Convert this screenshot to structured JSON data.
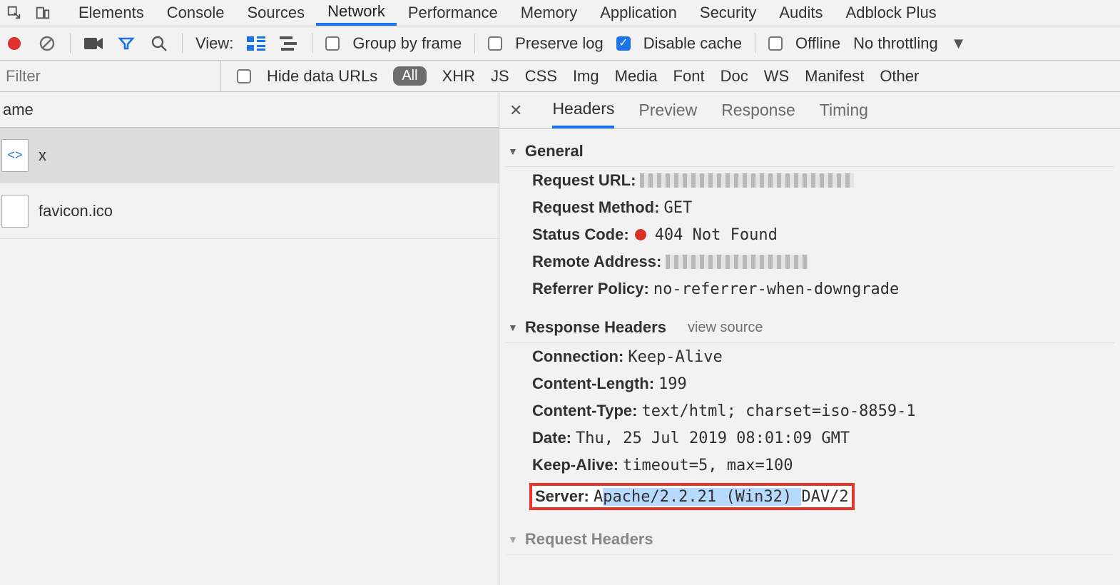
{
  "tabs": {
    "items": [
      "Elements",
      "Console",
      "Sources",
      "Network",
      "Performance",
      "Memory",
      "Application",
      "Security",
      "Audits",
      "Adblock Plus"
    ],
    "active": "Network"
  },
  "toolbar": {
    "view_label": "View:",
    "group_by_frame": "Group by frame",
    "preserve_log": "Preserve log",
    "disable_cache": "Disable cache",
    "offline": "Offline",
    "throttling": "No throttling"
  },
  "filter": {
    "placeholder": "Filter",
    "hide_data_urls": "Hide data URLs",
    "pill_all": "All",
    "types": [
      "XHR",
      "JS",
      "CSS",
      "Img",
      "Media",
      "Font",
      "Doc",
      "WS",
      "Manifest",
      "Other"
    ]
  },
  "requests": {
    "column_name": "ame",
    "rows": [
      {
        "name": "x",
        "selected": true,
        "icon": "html"
      },
      {
        "name": "favicon.ico",
        "selected": false,
        "icon": "blank"
      }
    ]
  },
  "detail": {
    "tabs": [
      "Headers",
      "Preview",
      "Response",
      "Timing"
    ],
    "active": "Headers",
    "general": {
      "title": "General",
      "request_url_label": "Request URL:",
      "request_method_label": "Request Method:",
      "request_method": "GET",
      "status_code_label": "Status Code:",
      "status_code": "404 Not Found",
      "remote_address_label": "Remote Address:",
      "referrer_policy_label": "Referrer Policy:",
      "referrer_policy": "no-referrer-when-downgrade"
    },
    "response_headers": {
      "title": "Response Headers",
      "view_source": "view source",
      "items": [
        {
          "k": "Connection:",
          "v": "Keep-Alive"
        },
        {
          "k": "Content-Length:",
          "v": "199"
        },
        {
          "k": "Content-Type:",
          "v": "text/html; charset=iso-8859-1"
        },
        {
          "k": "Date:",
          "v": "Thu, 25 Jul 2019 08:01:09 GMT"
        },
        {
          "k": "Keep-Alive:",
          "v": "timeout=5, max=100"
        }
      ],
      "server_label": "Server:",
      "server_value_prefix": "A",
      "server_value_hl": "pache/2.2.21 (Win32) ",
      "server_value_suffix": "DAV/2"
    },
    "request_headers_title": "Request Headers"
  }
}
